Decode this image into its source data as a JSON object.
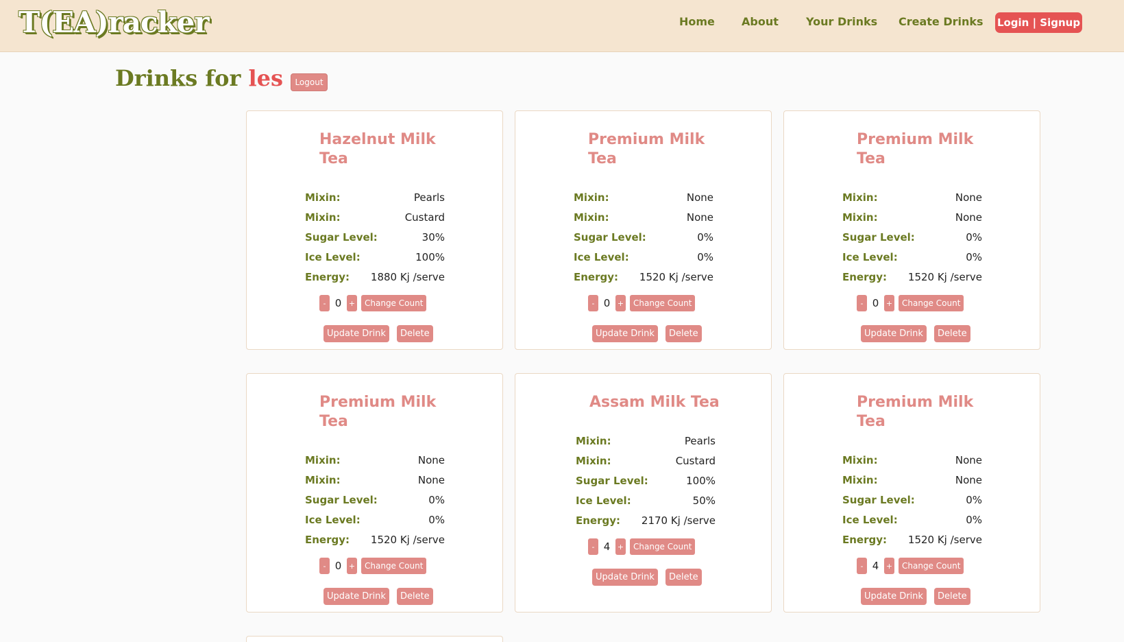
{
  "header": {
    "brand": "T(EA)racker",
    "nav": {
      "home": "Home",
      "about": "About",
      "your_drinks": "Your Drinks",
      "create_drinks": "Create Drinks",
      "login": "Login | Signup"
    }
  },
  "page": {
    "title_prefix": "Drinks for ",
    "username": "les",
    "logout": "Logout"
  },
  "labels": {
    "mixin": "Mixin:",
    "sugar": "Sugar Level:",
    "ice": "Ice Level:",
    "energy": "Energy:",
    "minus": "-",
    "plus": "+",
    "change_count": "Change Count",
    "update": "Update Drink",
    "delete": "Delete"
  },
  "drinks": [
    {
      "name": "Hazelnut Milk Tea",
      "mixin1": "Pearls",
      "mixin2": "Custard",
      "sugar": "30%",
      "ice": "100%",
      "energy": "1880 Kj /serve",
      "count": "0"
    },
    {
      "name": "Premium Milk Tea",
      "mixin1": "None",
      "mixin2": "None",
      "sugar": "0%",
      "ice": "0%",
      "energy": "1520 Kj /serve",
      "count": "0"
    },
    {
      "name": "Premium Milk Tea",
      "mixin1": "None",
      "mixin2": "None",
      "sugar": "0%",
      "ice": "0%",
      "energy": "1520 Kj /serve",
      "count": "0"
    },
    {
      "name": "Premium Milk Tea",
      "mixin1": "None",
      "mixin2": "None",
      "sugar": "0%",
      "ice": "0%",
      "energy": "1520 Kj /serve",
      "count": "0"
    },
    {
      "name": "Assam Milk Tea",
      "mixin1": "Pearls",
      "mixin2": "Custard",
      "sugar": "100%",
      "ice": "50%",
      "energy": "2170 Kj /serve",
      "count": "4"
    },
    {
      "name": "Premium Milk Tea",
      "mixin1": "None",
      "mixin2": "None",
      "sugar": "0%",
      "ice": "0%",
      "energy": "1520 Kj /serve",
      "count": "4"
    }
  ],
  "colors": {
    "navbar_bg": "#f5e5d0",
    "olive": "#6b7a22",
    "accent_red": "#e55353",
    "soft_pink": "#e08a86"
  }
}
